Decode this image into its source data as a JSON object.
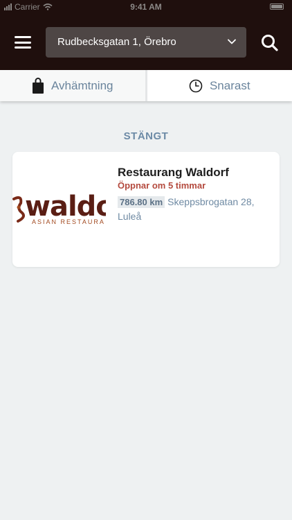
{
  "status_bar": {
    "carrier": "Carrier",
    "time": "9:41 AM"
  },
  "header": {
    "address": "Rudbecksgatan 1, Örebro"
  },
  "tabs": [
    {
      "label": "Avhämtning",
      "icon": "bag-icon"
    },
    {
      "label": "Snarast",
      "icon": "clock-icon"
    }
  ],
  "section": {
    "label": "STÄNGT"
  },
  "restaurant": {
    "name": "Restaurang Waldorf",
    "opening": "Öppnar om 5 timmar",
    "distance": "786.80 km",
    "address": "Skeppsbrogatan 28, Luleå",
    "logo_word": "waldor",
    "logo_sub": "ASIAN RESTAURA"
  },
  "colors": {
    "header_bg": "#1f0f0d",
    "accent_closed": "#b44a3e",
    "muted_blue": "#6c8aa6"
  }
}
